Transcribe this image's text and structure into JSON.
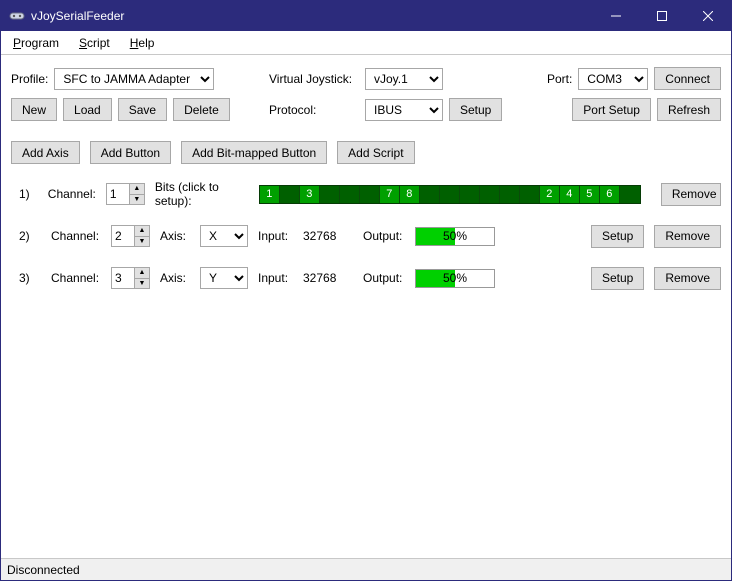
{
  "window": {
    "title": "vJoySerialFeeder"
  },
  "menu": {
    "program": "Program",
    "script": "Script",
    "help": "Help"
  },
  "profile": {
    "label": "Profile:",
    "selected": "SFC to JAMMA Adapter",
    "new_btn": "New",
    "load_btn": "Load",
    "save_btn": "Save",
    "delete_btn": "Delete"
  },
  "joystick": {
    "label": "Virtual Joystick:",
    "selected": "vJoy.1"
  },
  "protocol": {
    "label": "Protocol:",
    "selected": "IBUS",
    "setup_btn": "Setup"
  },
  "port": {
    "label": "Port:",
    "selected": "COM3",
    "connect_btn": "Connect",
    "setup_btn": "Port Setup",
    "refresh_btn": "Refresh"
  },
  "add": {
    "axis": "Add Axis",
    "button": "Add Button",
    "bitmapped": "Add Bit-mapped Button",
    "script": "Add Script"
  },
  "common": {
    "channel_label": "Channel:",
    "axis_label": "Axis:",
    "input_label": "Input:",
    "output_label": "Output:",
    "setup_btn": "Setup",
    "remove_btn": "Remove",
    "bits_label": "Bits (click to setup):"
  },
  "rows": [
    {
      "index": "1)",
      "channel": "1",
      "type": "bits",
      "bits": [
        "1",
        "",
        "3",
        "",
        "",
        "",
        "7",
        "8",
        "",
        "",
        "",
        "",
        "",
        "",
        "2",
        "4",
        "5",
        "6",
        ""
      ]
    },
    {
      "index": "2)",
      "channel": "2",
      "type": "axis",
      "axis": "X",
      "input": "32768",
      "output_text": "50%",
      "output_pct": 50
    },
    {
      "index": "3)",
      "channel": "3",
      "type": "axis",
      "axis": "Y",
      "input": "32768",
      "output_text": "50%",
      "output_pct": 50
    }
  ],
  "status": "Disconnected"
}
